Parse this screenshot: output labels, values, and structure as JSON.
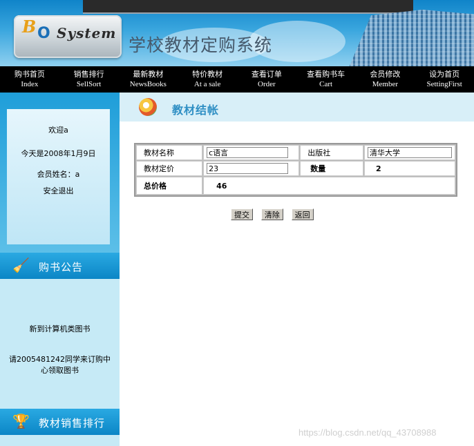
{
  "header": {
    "logo_b": "B",
    "logo_o": "O",
    "logo_system": "System",
    "site_title": "学校教材定购系统"
  },
  "nav": [
    {
      "zh": "购书首页",
      "en": "Index"
    },
    {
      "zh": "销售排行",
      "en": "SellSort"
    },
    {
      "zh": "最新教材",
      "en": "NewsBooks"
    },
    {
      "zh": "特价教材",
      "en": "At a sale"
    },
    {
      "zh": "查看订单",
      "en": "Order"
    },
    {
      "zh": "查看购书车",
      "en": "Cart"
    },
    {
      "zh": "会员修改",
      "en": "Member"
    },
    {
      "zh": "设为首页",
      "en": "SettingFirst"
    }
  ],
  "sidebar": {
    "welcome": "欢迎a",
    "date": "今天是2008年1月9日",
    "member": "会员姓名：a",
    "logout": "安全退出",
    "notice_title": "购书公告",
    "notice_1": "新到计算机类图书",
    "notice_2": "请2005481242同学来订购中心领取图书",
    "ranking_title": "教材销售排行"
  },
  "main": {
    "section_title": "教材结帐",
    "form": {
      "name_label": "教材名称",
      "name_value": "c语言",
      "publisher_label": "出版社",
      "publisher_value": "清华大学",
      "price_label": "教材定价",
      "price_value": "23",
      "qty_label": "数量",
      "qty_value": "2",
      "total_label": "总价格",
      "total_value": "46"
    },
    "buttons": {
      "submit": "提交",
      "clear": "清除",
      "back": "返回"
    }
  },
  "watermark": "https://blog.csdn.net/qq_43708988"
}
